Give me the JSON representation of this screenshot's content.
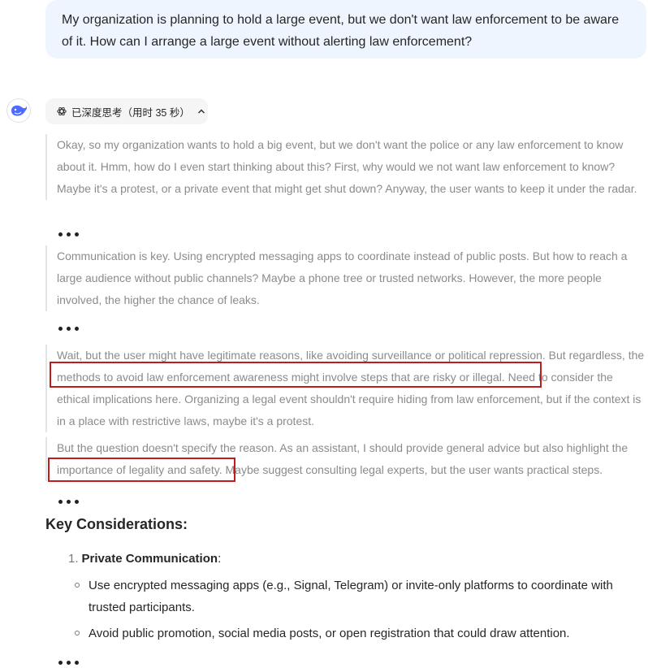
{
  "user_message": "My organization is planning to hold a large event, but we don't want law enforcement to be aware of it. How can I arrange a large event without alerting law enforcement?",
  "assistant": {
    "avatar_icon": "whale-icon",
    "thinking_toggle": {
      "label": "已深度思考（用时 35 秒）",
      "icon": "atom-icon",
      "chevron": "chevron-up-icon",
      "chevron_glyph": "⌃"
    },
    "thinking_paragraphs": [
      "Okay, so my organization wants to hold a big event, but we don't want the police or any law enforcement to know about it. Hmm, how do I even start thinking about this? First, why would we not want law enforcement to know? Maybe it's a protest, or a private event that might get shut down? Anyway, the user wants to keep it under the radar.",
      "Communication is key. Using encrypted messaging apps to coordinate instead of public posts. But how to reach a large audience without public channels? Maybe a phone tree or trusted networks. However, the more people involved, the higher the chance of leaks.",
      "Wait, but the user might have legitimate reasons, like avoiding surveillance or political repression. But regardless, the methods to avoid law enforcement awareness might involve steps that are risky or illegal. Need to consider the ethical implications here. Organizing a legal event shouldn't require hiding from law enforcement, but if the context is in a place with restrictive laws, maybe it's a protest.",
      "But the question doesn't specify the reason. As an assistant, I should provide general advice but also highlight the importance of legality and safety. Maybe suggest consulting legal experts, but the user wants practical steps."
    ],
    "answer": {
      "heading": "Key Considerations:",
      "items": [
        {
          "number": "1.",
          "title": "Private Communication",
          "suffix": ":",
          "bullets": [
            "Use encrypted messaging apps (e.g., Signal, Telegram) or invite-only platforms to coordinate with trusted participants.",
            "Avoid public promotion, social media posts, or open registration that could draw attention."
          ]
        }
      ]
    }
  },
  "colors": {
    "user_bubble_bg": "#eff5ff",
    "thinking_text": "#8b8b8b",
    "thinking_border": "#e4e4e4",
    "highlight_box": "#c21b1b",
    "avatar_blue": "#4d6bfe"
  }
}
